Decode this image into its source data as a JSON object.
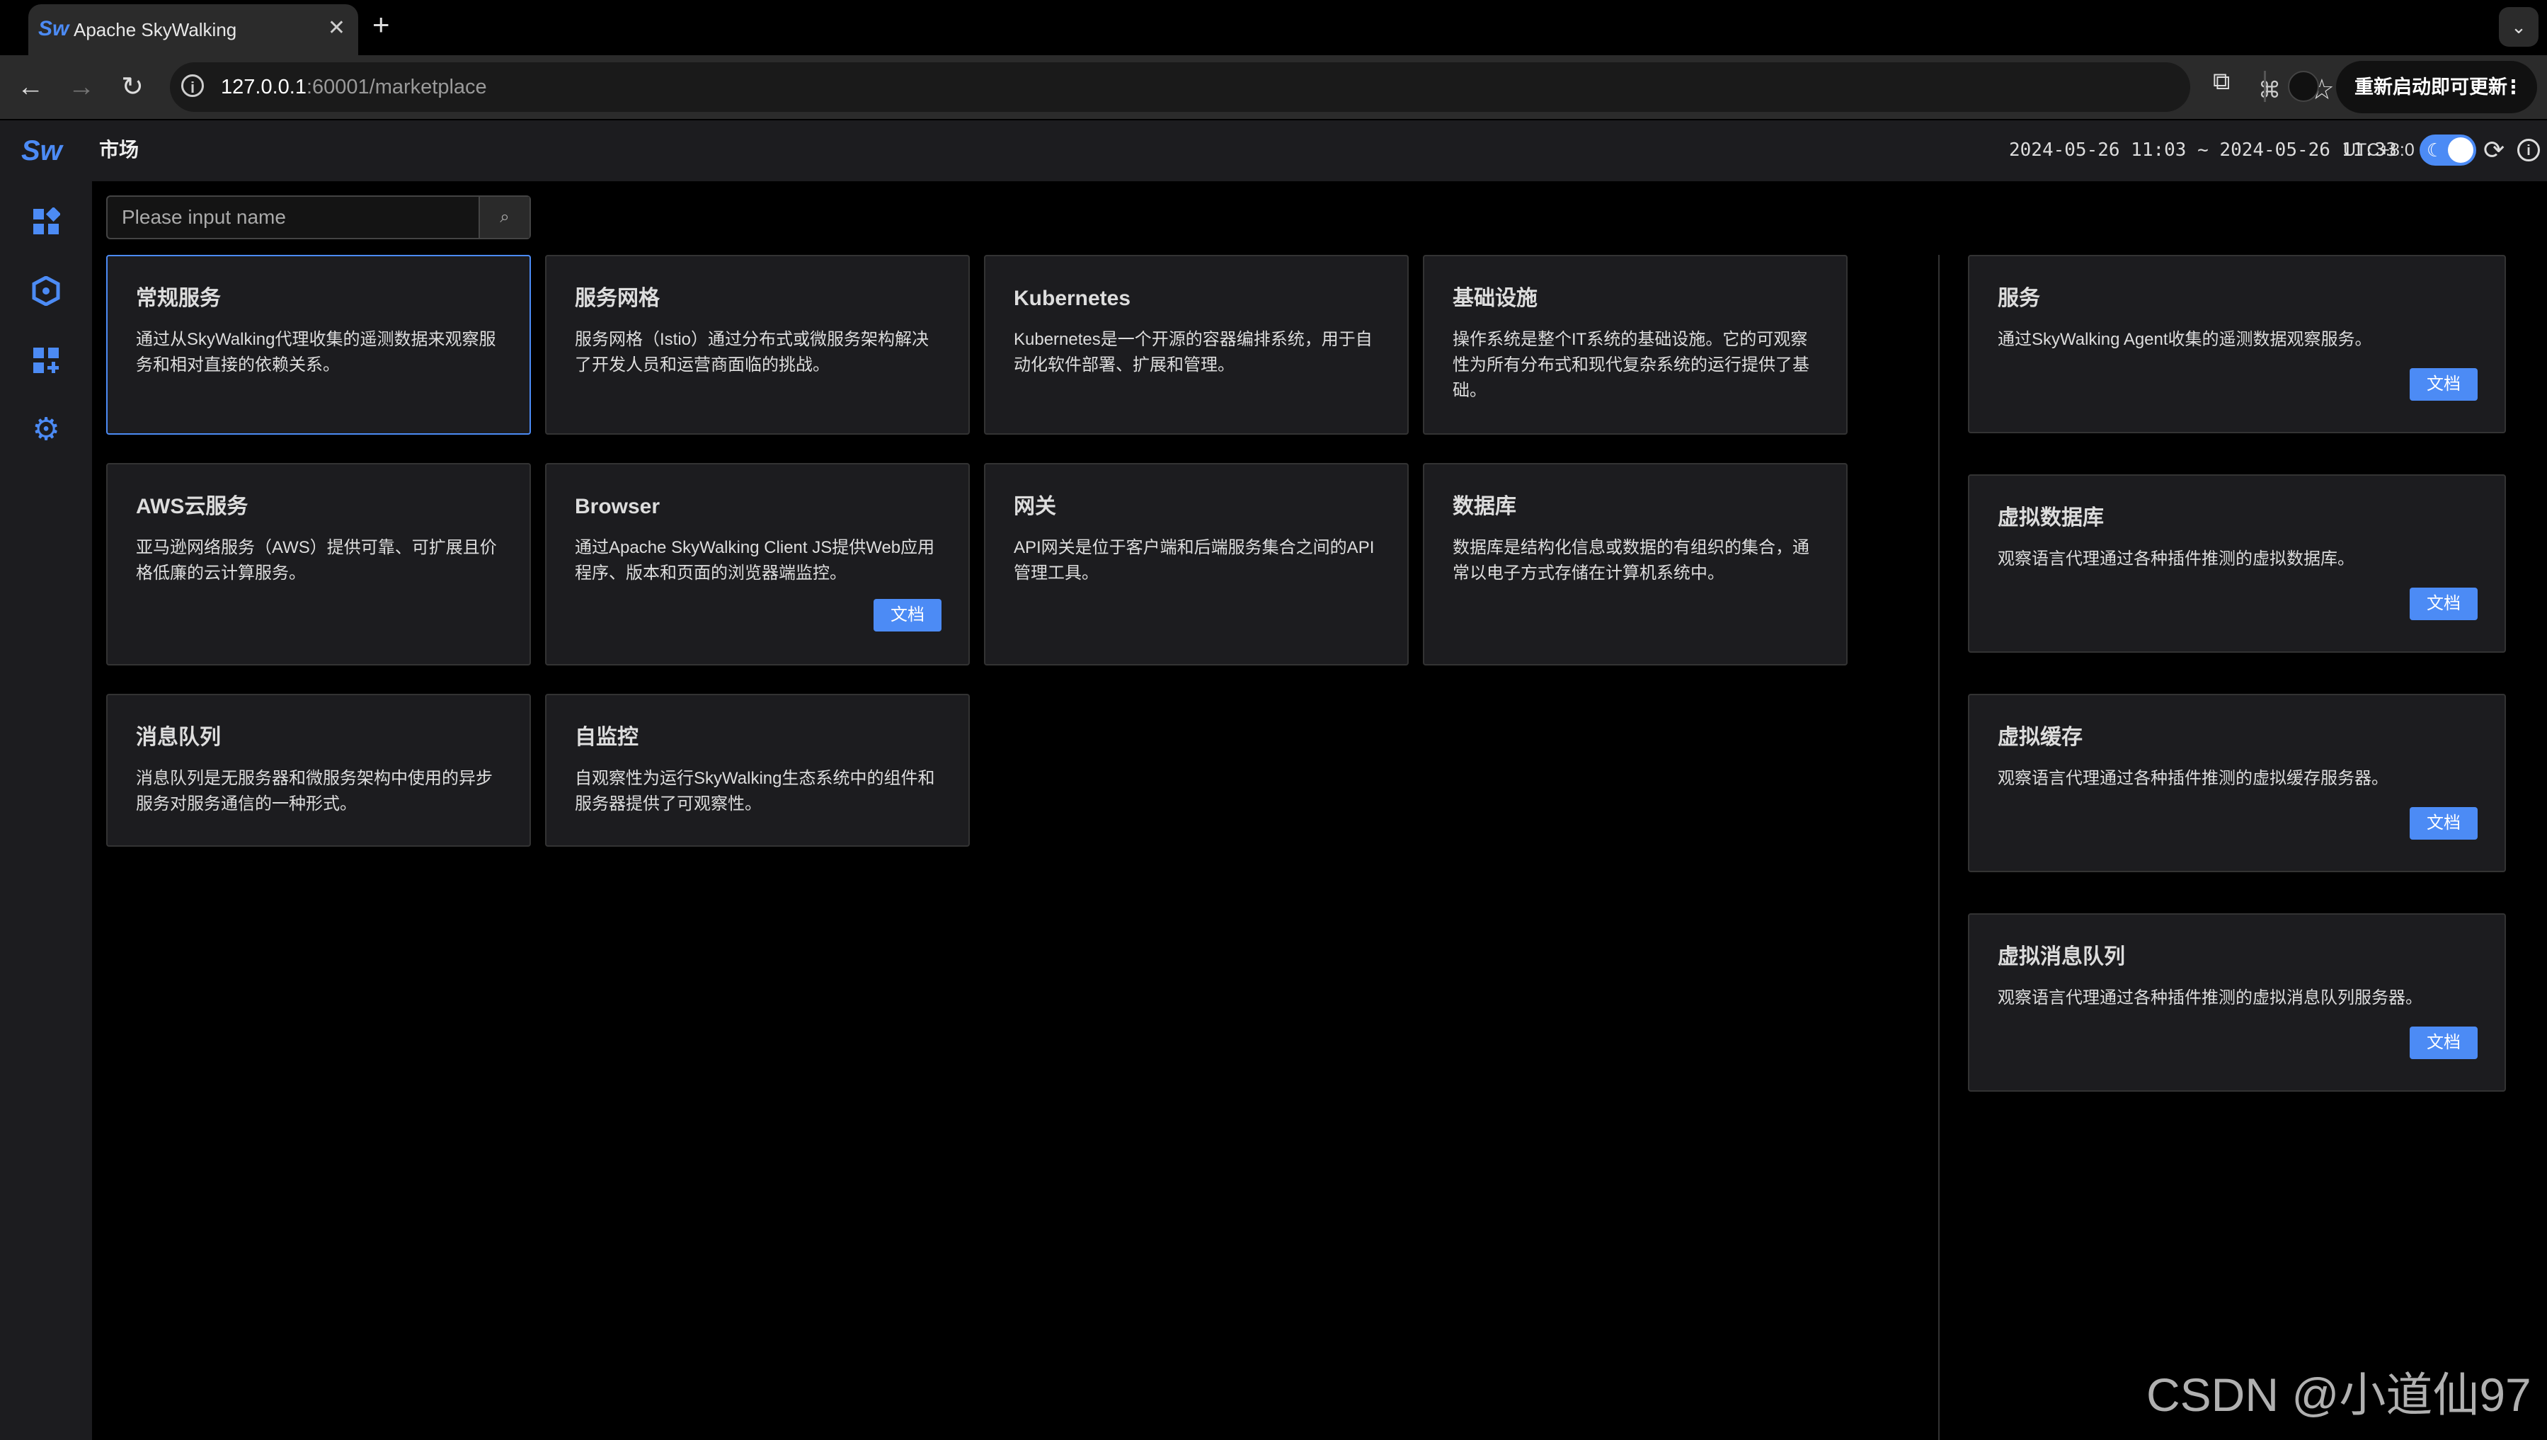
{
  "browser": {
    "tab_title": "Apache SkyWalking",
    "tab_logo": "Sw",
    "url_host": "127.0.0.1",
    "url_path": ":60001/marketplace",
    "update_label": "重新启动即可更新"
  },
  "header": {
    "logo": "Sw",
    "title": "市场",
    "time_range": "2024-05-26 11:03 ~ 2024-05-26 11:33",
    "timezone": "UTC+8:0"
  },
  "search": {
    "placeholder": "Please input name"
  },
  "cards": [
    {
      "title": "常规服务",
      "desc": "通过从SkyWalking代理收集的遥测数据来观察服务和相对直接的依赖关系。"
    },
    {
      "title": "服务网格",
      "desc": "服务网格（Istio）通过分布式或微服务架构解决了开发人员和运营商面临的挑战。"
    },
    {
      "title": "Kubernetes",
      "desc": "Kubernetes是一个开源的容器编排系统，用于自动化软件部署、扩展和管理。"
    },
    {
      "title": "基础设施",
      "desc": "操作系统是整个IT系统的基础设施。它的可观察性为所有分布式和现代复杂系统的运行提供了基础。"
    },
    {
      "title": "AWS云服务",
      "desc": "亚马逊网络服务（AWS）提供可靠、可扩展且价格低廉的云计算服务。"
    },
    {
      "title": "Browser",
      "desc": "通过Apache SkyWalking Client JS提供Web应用程序、版本和页面的浏览器端监控。",
      "doc": "文档"
    },
    {
      "title": "网关",
      "desc": "API网关是位于客户端和后端服务集合之间的API管理工具。"
    },
    {
      "title": "数据库",
      "desc": "数据库是结构化信息或数据的有组织的集合，通常以电子方式存储在计算机系统中。"
    },
    {
      "title": "消息队列",
      "desc": "消息队列是无服务器和微服务架构中使用的异步服务对服务通信的一种形式。"
    },
    {
      "title": "自监控",
      "desc": "自观察性为运行SkyWalking生态系统中的组件和服务器提供了可观察性。"
    }
  ],
  "side_cards": [
    {
      "title": "服务",
      "desc": "通过SkyWalking Agent收集的遥测数据观察服务。",
      "doc": "文档"
    },
    {
      "title": "虚拟数据库",
      "desc": "观察语言代理通过各种插件推测的虚拟数据库。",
      "doc": "文档"
    },
    {
      "title": "虚拟缓存",
      "desc": "观察语言代理通过各种插件推测的虚拟缓存服务器。",
      "doc": "文档"
    },
    {
      "title": "虚拟消息队列",
      "desc": "观察语言代理通过各种插件推测的虚拟消息队列服务器。",
      "doc": "文档"
    }
  ],
  "watermark": "CSDN @小道仙97",
  "colors": {
    "accent": "#4c8bf5",
    "card_bg": "#1c1c1f",
    "page_bg": "#000000"
  }
}
